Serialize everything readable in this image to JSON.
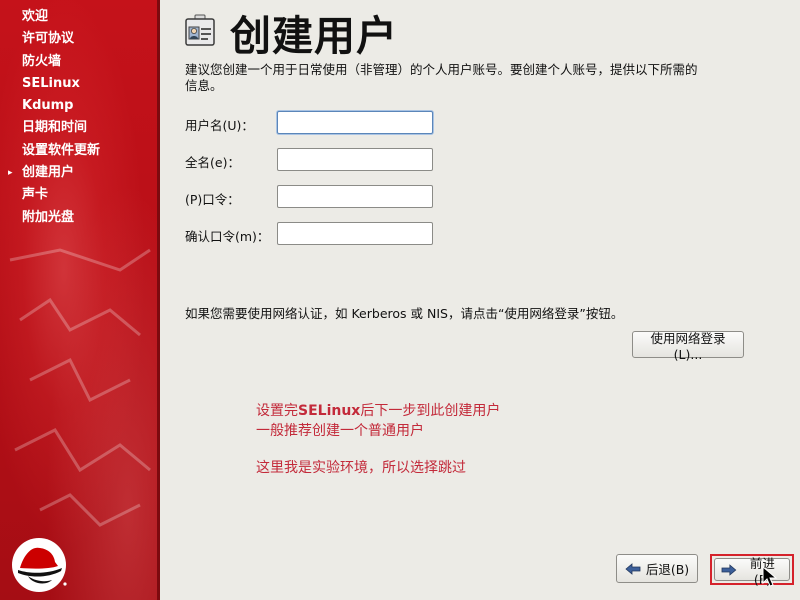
{
  "sidebar": {
    "items": [
      {
        "label": "欢迎",
        "current": false
      },
      {
        "label": "许可协议",
        "current": false
      },
      {
        "label": "防火墙",
        "current": false
      },
      {
        "label": "SELinux",
        "current": false
      },
      {
        "label": "Kdump",
        "current": false
      },
      {
        "label": "日期和时间",
        "current": false
      },
      {
        "label": "设置软件更新",
        "current": false
      },
      {
        "label": "创建用户",
        "current": true
      },
      {
        "label": "声卡",
        "current": false
      },
      {
        "label": "附加光盘",
        "current": false
      }
    ],
    "current_marker": "▸"
  },
  "header": {
    "title": "创建用户",
    "icon": "user-id-card-icon"
  },
  "main": {
    "description": "建议您创建一个用于日常使用（非管理）的个人用户账号。要创建个人账号，提供以下所需的信息。",
    "fields": [
      {
        "label": "用户名(U)：",
        "mnemonic": "U",
        "value": "",
        "focused": true
      },
      {
        "label": "全名(e)：",
        "mnemonic": "e",
        "value": "",
        "focused": false
      },
      {
        "label": "(P)口令：",
        "mnemonic": "P",
        "value": "",
        "focused": false
      },
      {
        "label": "确认口令(m)：",
        "mnemonic": "m",
        "value": "",
        "focused": false
      }
    ],
    "network_text": "如果您需要使用网络认证，如 Kerberos 或 NIS，请点击“使用网络登录”按钮。",
    "network_button": "使用网络登录(L)..."
  },
  "annotation": {
    "line1_prefix": "设置完",
    "line1_bold": "SELinux",
    "line1_suffix": "后下一步到此创建用户",
    "line2": "一般推荐创建一个普通用户",
    "line3": "这里我是实验环境，所以选择跳过",
    "color": "#c32a3a"
  },
  "footer": {
    "back_label": "后退(B)",
    "forward_label": "前进(F)"
  },
  "colors": {
    "sidebar_red": "#b80f17",
    "highlight_border": "#d5222b",
    "focus_border": "#5b86b9"
  }
}
